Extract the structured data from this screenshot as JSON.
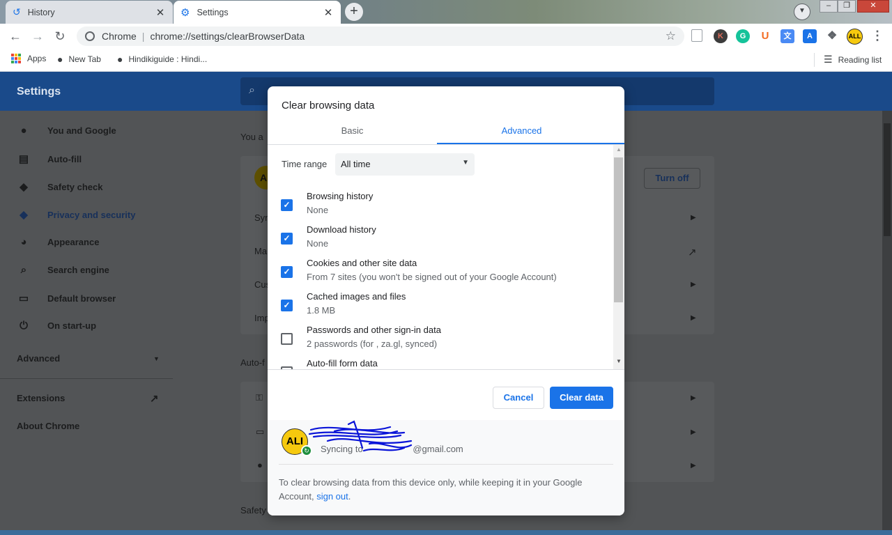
{
  "tabs": [
    {
      "title": "History",
      "icon": "history-icon"
    },
    {
      "title": "Settings",
      "icon": "gear-icon"
    }
  ],
  "omnibox": {
    "scheme": "Chrome",
    "separator": "|",
    "url": "chrome://settings/clearBrowserData"
  },
  "extensions": {
    "avatar_initials": "ALL"
  },
  "bookmarks": {
    "apps": "Apps",
    "new_tab": "New Tab",
    "hindiki": "Hindikiguide : Hindi...",
    "reading_list": "Reading list"
  },
  "settings": {
    "title": "Settings",
    "sidebar": [
      {
        "label": "You and Google",
        "icon": "person-icon"
      },
      {
        "label": "Auto-fill",
        "icon": "clipboard-icon"
      },
      {
        "label": "Safety check",
        "icon": "shield-check-icon"
      },
      {
        "label": "Privacy and security",
        "icon": "shield-icon"
      },
      {
        "label": "Appearance",
        "icon": "palette-icon"
      },
      {
        "label": "Search engine",
        "icon": "search-icon"
      },
      {
        "label": "Default browser",
        "icon": "browser-icon"
      },
      {
        "label": "On start-up",
        "icon": "power-icon"
      }
    ],
    "advanced": "Advanced",
    "extensions": "Extensions",
    "about": "About Chrome",
    "peek": {
      "you_a": "You a",
      "syn": "Syn",
      "ma": "Ma",
      "cus": "Cus",
      "imp": "Imp",
      "auto_f": "Auto-f",
      "safety": "Safety",
      "turn_off": "Turn off",
      "avatar_initials": "AL"
    }
  },
  "dialog": {
    "title": "Clear browsing data",
    "tabs": {
      "basic": "Basic",
      "advanced": "Advanced"
    },
    "time_range": {
      "label": "Time range",
      "value": "All time"
    },
    "options": [
      {
        "title": "Browsing history",
        "subtitle": "None",
        "checked": true
      },
      {
        "title": "Download history",
        "subtitle": "None",
        "checked": true
      },
      {
        "title": "Cookies and other site data",
        "subtitle": "From 7 sites (you won't be signed out of your Google Account)",
        "checked": true
      },
      {
        "title": "Cached images and files",
        "subtitle": "1.8 MB",
        "checked": true
      },
      {
        "title": "Passwords and other sign-in data",
        "subtitle": "2 passwords (for , za.gl, synced)",
        "checked": false
      },
      {
        "title": "Auto-fill form data",
        "subtitle": "",
        "checked": false
      }
    ],
    "cancel": "Cancel",
    "clear": "Clear data",
    "sync": {
      "avatar": "ALI",
      "text": "Syncing to ",
      "email_suffix": "@gmail.com"
    },
    "footer_note": "To clear browsing data from this device only, while keeping it in your Google Account, ",
    "sign_out": "sign out",
    "footer_end": "."
  },
  "colors": {
    "accent": "#1a73e8",
    "header": "#1a4a8a",
    "check_on": "#1a73e8",
    "sync_green": "#1e8e3e"
  }
}
